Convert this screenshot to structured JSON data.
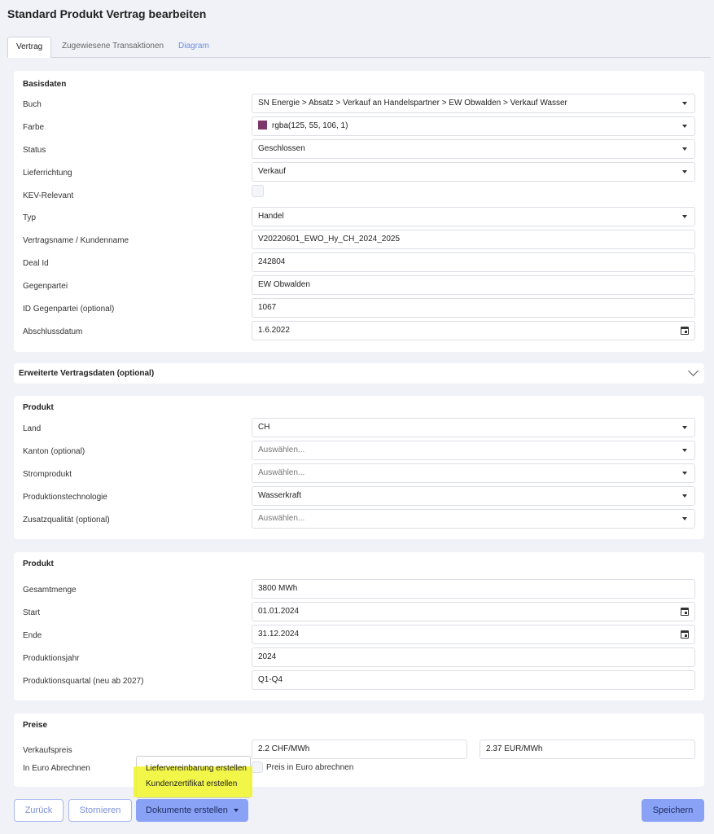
{
  "page": {
    "title": "Standard Produkt Vertrag bearbeiten"
  },
  "tabs": [
    {
      "label": "Vertrag"
    },
    {
      "label": "Zugewiesene Transaktionen"
    },
    {
      "label": "Diagram"
    }
  ],
  "basisdaten": {
    "title": "Basisdaten",
    "buch": {
      "label": "Buch",
      "value": "SN Energie > Absatz > Verkauf an Handelspartner > EW Obwalden > Verkauf Wasser"
    },
    "farbe": {
      "label": "Farbe",
      "value": "rgba(125, 55, 106, 1)",
      "swatch_color": "#7d376a"
    },
    "status": {
      "label": "Status",
      "value": "Geschlossen"
    },
    "lieferrichtung": {
      "label": "Lieferrichtung",
      "value": "Verkauf"
    },
    "kev": {
      "label": "KEV-Relevant"
    },
    "typ": {
      "label": "Typ",
      "value": "Handel"
    },
    "vertragsname": {
      "label": "Vertragsname / Kundenname",
      "value": "V20220601_EWO_Hy_CH_2024_2025"
    },
    "deal_id": {
      "label": "Deal Id",
      "value": "242804"
    },
    "gegenpartei": {
      "label": "Gegenpartei",
      "value": "EW Obwalden"
    },
    "id_gegenpartei": {
      "label": "ID Gegenpartei (optional)",
      "value": "1067"
    },
    "abschlussdatum": {
      "label": "Abschlussdatum",
      "value": "1.6.2022"
    }
  },
  "erweitert": {
    "title": "Erweiterte Vertragsdaten (optional)"
  },
  "produkt1": {
    "title": "Produkt",
    "land": {
      "label": "Land",
      "value": "CH"
    },
    "kanton": {
      "label": "Kanton (optional)",
      "placeholder": "Auswählen..."
    },
    "stromprodukt": {
      "label": "Stromprodukt",
      "placeholder": "Auswählen..."
    },
    "produktionstechnologie": {
      "label": "Produktionstechnologie",
      "value": "Wasserkraft"
    },
    "zusatzqualitaet": {
      "label": "Zusatzqualität (optional)",
      "placeholder": "Auswählen..."
    }
  },
  "produkt2": {
    "title": "Produkt",
    "gesamtmenge": {
      "label": "Gesamtmenge",
      "value": "3800 MWh"
    },
    "start": {
      "label": "Start",
      "value": "01.01.2024"
    },
    "ende": {
      "label": "Ende",
      "value": "31.12.2024"
    },
    "produktionsjahr": {
      "label": "Produktionsjahr",
      "value": "2024"
    },
    "produktionsquartal": {
      "label": "Produktionsquartal (neu ab 2027)",
      "value": "Q1-Q4"
    }
  },
  "preise": {
    "title": "Preise",
    "verkaufspreis": {
      "label": "Verkaufspreis",
      "value_chf": "2.2 CHF/MWh",
      "value_eur": "2.37 EUR/MWh"
    },
    "in_euro": {
      "label": "In Euro Abrechnen",
      "checkbox_label": "Preis in Euro abrechnen"
    }
  },
  "dropdown_menu": {
    "items": [
      "Liefervereinbarung erstellen",
      "Kundenzertifikat erstellen"
    ],
    "highlight_color": "#f0f528"
  },
  "footer": {
    "back": "Zurück",
    "cancel": "Stornieren",
    "documents": "Dokumente erstellen",
    "save": "Speichern"
  }
}
